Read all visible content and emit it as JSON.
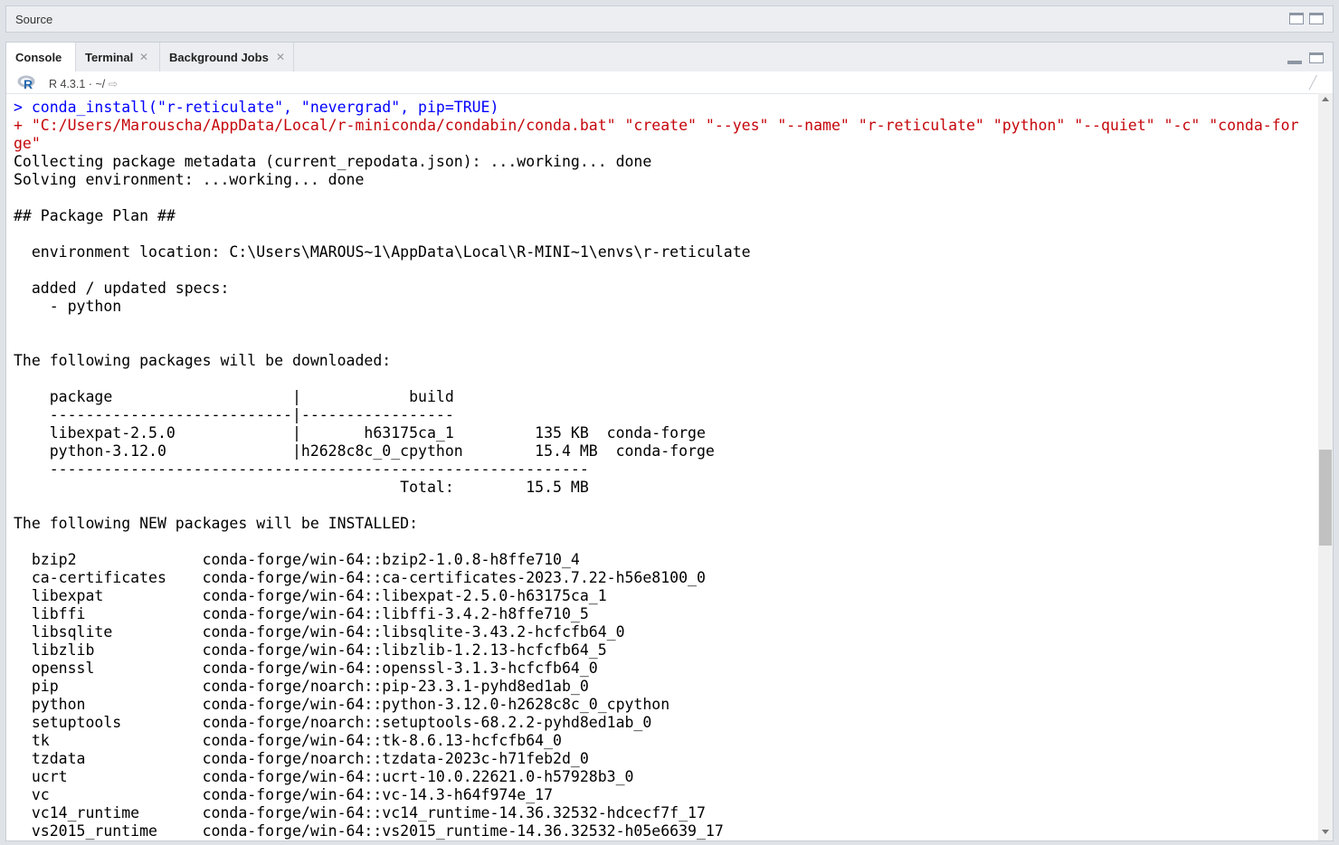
{
  "source_pane": {
    "title": "Source"
  },
  "tabs": [
    {
      "label": "Console",
      "closable": false
    },
    {
      "label": "Terminal",
      "closable": true
    },
    {
      "label": "Background Jobs",
      "closable": true
    }
  ],
  "toolbar": {
    "r_version": "R 4.3.1",
    "separator": "·",
    "working_dir": "~/"
  },
  "console": {
    "lines": [
      {
        "text": "> conda_install(\"r-reticulate\", \"nevergrad\", pip=TRUE)",
        "style": "blue"
      },
      {
        "text": "+ \"C:/Users/Marouscha/AppData/Local/r-miniconda/condabin/conda.bat\" \"create\" \"--yes\" \"--name\" \"r-reticulate\" \"python\" \"--quiet\" \"-c\" \"conda-for",
        "style": "red"
      },
      {
        "text": "ge\"",
        "style": "red"
      },
      {
        "text": "Collecting package metadata (current_repodata.json): ...working... done",
        "style": ""
      },
      {
        "text": "Solving environment: ...working... done",
        "style": ""
      },
      {
        "text": "",
        "style": ""
      },
      {
        "text": "## Package Plan ##",
        "style": ""
      },
      {
        "text": "",
        "style": ""
      },
      {
        "text": "  environment location: C:\\Users\\MAROUS~1\\AppData\\Local\\R-MINI~1\\envs\\r-reticulate",
        "style": ""
      },
      {
        "text": "",
        "style": ""
      },
      {
        "text": "  added / updated specs:",
        "style": ""
      },
      {
        "text": "    - python",
        "style": ""
      },
      {
        "text": "",
        "style": ""
      },
      {
        "text": "",
        "style": ""
      },
      {
        "text": "The following packages will be downloaded:",
        "style": ""
      },
      {
        "text": "",
        "style": ""
      },
      {
        "text": "    package                    |            build",
        "style": ""
      },
      {
        "text": "    ---------------------------|-----------------",
        "style": ""
      },
      {
        "text": "    libexpat-2.5.0             |       h63175ca_1         135 KB  conda-forge",
        "style": ""
      },
      {
        "text": "    python-3.12.0              |h2628c8c_0_cpython        15.4 MB  conda-forge",
        "style": ""
      },
      {
        "text": "    ------------------------------------------------------------",
        "style": ""
      },
      {
        "text": "                                           Total:        15.5 MB",
        "style": ""
      },
      {
        "text": "",
        "style": ""
      },
      {
        "text": "The following NEW packages will be INSTALLED:",
        "style": ""
      },
      {
        "text": "",
        "style": ""
      },
      {
        "text": "  bzip2              conda-forge/win-64::bzip2-1.0.8-h8ffe710_4",
        "style": ""
      },
      {
        "text": "  ca-certificates    conda-forge/win-64::ca-certificates-2023.7.22-h56e8100_0",
        "style": ""
      },
      {
        "text": "  libexpat           conda-forge/win-64::libexpat-2.5.0-h63175ca_1",
        "style": ""
      },
      {
        "text": "  libffi             conda-forge/win-64::libffi-3.4.2-h8ffe710_5",
        "style": ""
      },
      {
        "text": "  libsqlite          conda-forge/win-64::libsqlite-3.43.2-hcfcfb64_0",
        "style": ""
      },
      {
        "text": "  libzlib            conda-forge/win-64::libzlib-1.2.13-hcfcfb64_5",
        "style": ""
      },
      {
        "text": "  openssl            conda-forge/win-64::openssl-3.1.3-hcfcfb64_0",
        "style": ""
      },
      {
        "text": "  pip                conda-forge/noarch::pip-23.3.1-pyhd8ed1ab_0",
        "style": ""
      },
      {
        "text": "  python             conda-forge/win-64::python-3.12.0-h2628c8c_0_cpython",
        "style": ""
      },
      {
        "text": "  setuptools         conda-forge/noarch::setuptools-68.2.2-pyhd8ed1ab_0",
        "style": ""
      },
      {
        "text": "  tk                 conda-forge/win-64::tk-8.6.13-hcfcfb64_0",
        "style": ""
      },
      {
        "text": "  tzdata             conda-forge/noarch::tzdata-2023c-h71feb2d_0",
        "style": ""
      },
      {
        "text": "  ucrt               conda-forge/win-64::ucrt-10.0.22621.0-h57928b3_0",
        "style": ""
      },
      {
        "text": "  vc                 conda-forge/win-64::vc-14.3-h64f974e_17",
        "style": ""
      },
      {
        "text": "  vc14_runtime       conda-forge/win-64::vc14_runtime-14.36.32532-hdcecf7f_17",
        "style": ""
      },
      {
        "text": "  vs2015_runtime     conda-forge/win-64::vs2015_runtime-14.36.32532-h05e6639_17",
        "style": ""
      }
    ]
  },
  "scrollbar": {
    "position_fraction": 0.48
  },
  "colors": {
    "command": "#0000ff",
    "continuation": "#c5060b",
    "output": "#000000"
  }
}
